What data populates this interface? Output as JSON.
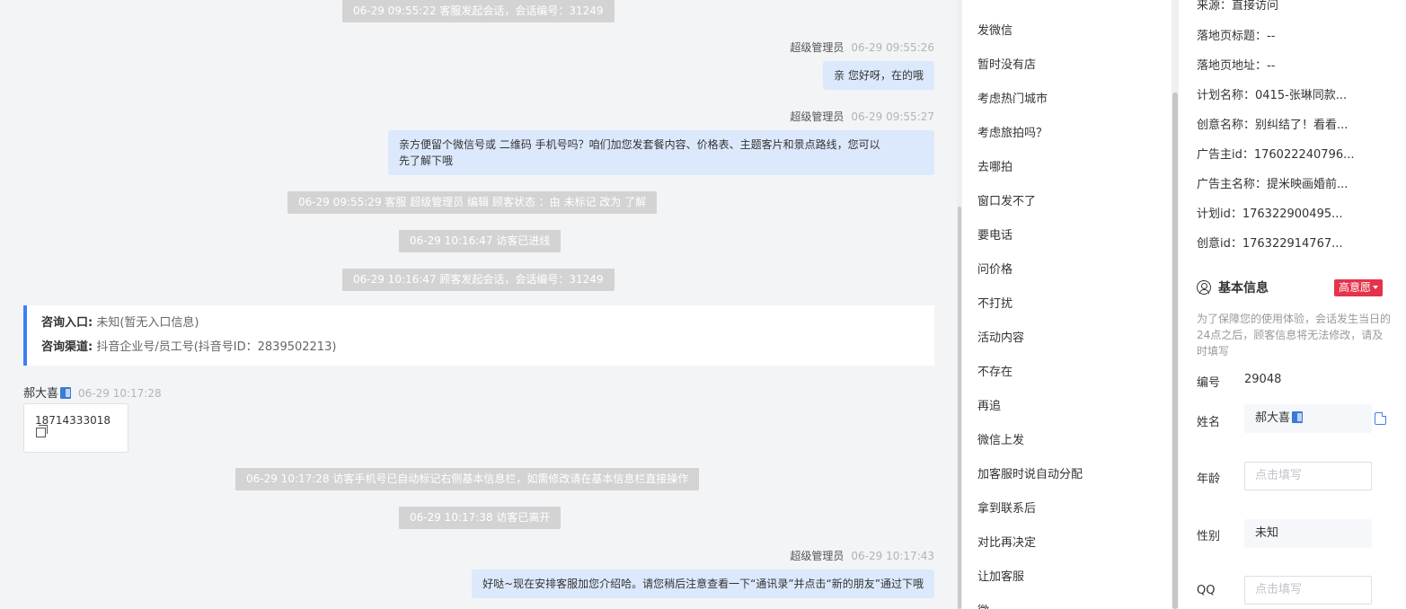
{
  "chat": {
    "sys1": "06-29 09:55:22 客服发起会话，会话编号：31249",
    "msg1": {
      "sender": "超级管理员",
      "time": "06-29 09:55:26",
      "text": "亲 您好呀，在的哦"
    },
    "msg2": {
      "sender": "超级管理员",
      "time": "06-29 09:55:27",
      "line1": "亲方便留个微信号或 二维码 手机号吗？咱们加您发套餐内容、价格表、主题客片和景点路线，您可以",
      "line2": "先了解下哦"
    },
    "sys2": "06-29 09:55:29 客服 超级管理员 编辑 顾客状态 ：由 未标记 改为 了解",
    "sys3": "06-29 10:16:47 访客已进线",
    "sys4": "06-29 10:16:47 顾客发起会话，会话编号：31249",
    "entry": {
      "k1": "咨询入口:",
      "v1": " 未知(暂无入口信息)",
      "k2": "咨询渠道:",
      "v2": " 抖音企业号/员工号(抖音号ID：2839502213)"
    },
    "visitor": {
      "name": "郝大喜",
      "time": "06-29 10:17:28",
      "phone": "18714333018"
    },
    "sys5": "06-29 10:17:28 访客手机号已自动标记右侧基本信息栏，如需修改请在基本信息栏直接操作",
    "sys6": "06-29 10:17:38 访客已离开",
    "msg3": {
      "sender": "超级管理员",
      "time": "06-29 10:17:43",
      "text": "好哒~现在安排客服加您介绍哈。请您稍后注意查看一下“通讯录”并点击“新的朋友”通过下哦"
    }
  },
  "tags": [
    "发微信",
    "暂时没有店",
    "考虑热门城市",
    "考虑旅拍吗？",
    "去哪拍",
    "窗口发不了",
    "要电话",
    "问价格",
    "不打扰",
    "活动内容",
    "不存在",
    "再追",
    "微信上发",
    "加客服时说自动分配",
    "拿到联系后",
    "对比再决定",
    "让加客服",
    "微"
  ],
  "panel": {
    "source": "来源：直接访问",
    "landing_title": "落地页标题：--",
    "landing_url": "落地页地址：--",
    "plan_name": "计划名称：0415-张琳同款...",
    "creative_name": "创意名称：别纠结了！看看...",
    "advertiser_id": "广告主id：176022240796...",
    "advertiser_name": "广告主名称：提米映画婚前...",
    "plan_id": "计划id：176322900495...",
    "creative_id": "创意id：176322914767...",
    "basic_title": "基本信息",
    "intent_badge": "高意愿",
    "note": "为了保障您的使用体验，会话发生当日的24点之后，顾客信息将无法修改，请及时填写",
    "fields": {
      "id_label": "编号",
      "id_value": "29048",
      "name_label": "姓名",
      "name_value": "郝大喜",
      "age_label": "年龄",
      "age_placeholder": "点击填写",
      "gender_label": "性别",
      "gender_value": "未知",
      "qq_label": "QQ",
      "qq_placeholder": "点击填写"
    }
  }
}
